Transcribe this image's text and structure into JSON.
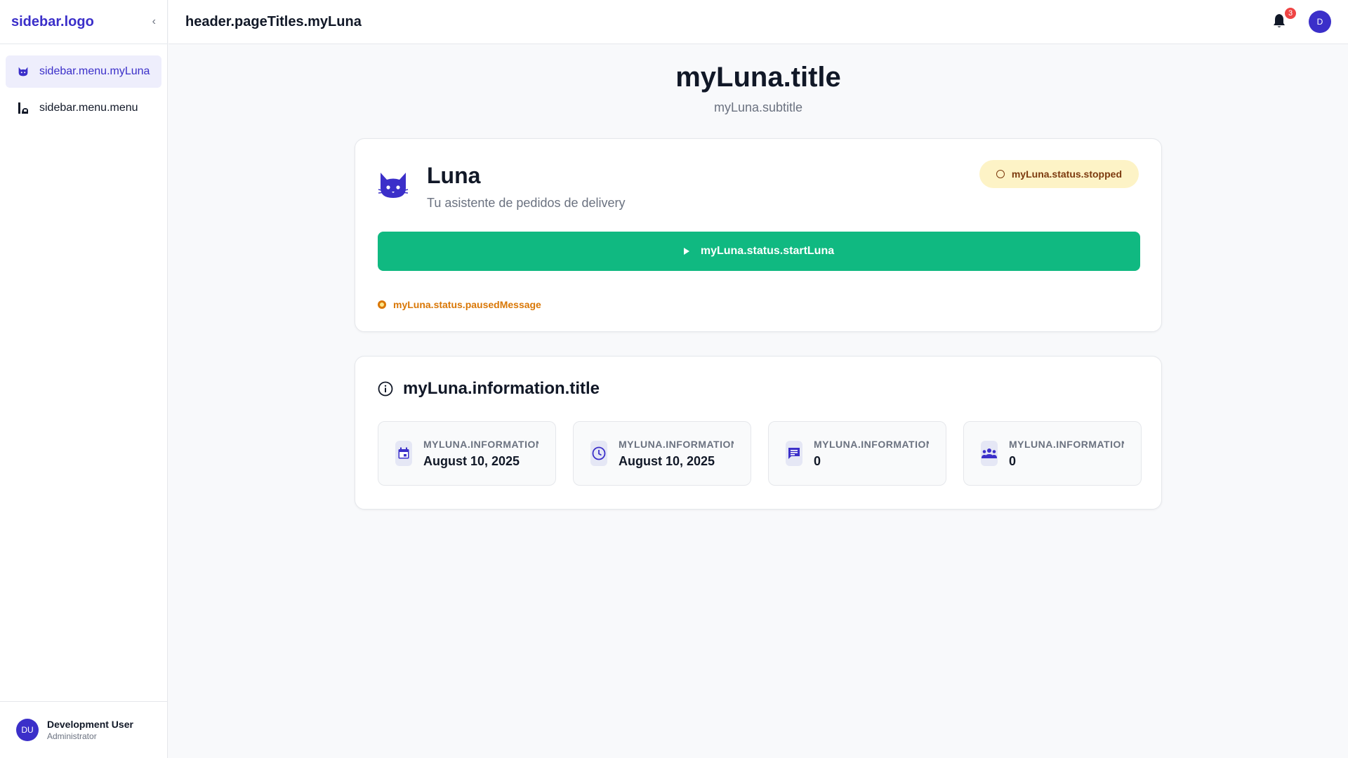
{
  "sidebar": {
    "logo": "sidebar.logo",
    "items": [
      {
        "label": "sidebar.menu.myLuna",
        "icon": "cat-icon",
        "active": true
      },
      {
        "label": "sidebar.menu.menu",
        "icon": "food-icon",
        "active": false
      }
    ],
    "user": {
      "initials": "DU",
      "name": "Development User",
      "role": "Administrator"
    }
  },
  "header": {
    "title": "header.pageTitles.myLuna",
    "notifications": "3",
    "avatar_initial": "D"
  },
  "main": {
    "title": "myLuna.title",
    "subtitle": "myLuna.subtitle",
    "luna": {
      "name": "Luna",
      "description": "Tu asistente de pedidos de delivery",
      "status": "myLuna.status.stopped",
      "start_button": "myLuna.status.startLuna",
      "paused_message": "myLuna.status.pausedMessage"
    },
    "information": {
      "title": "myLuna.information.title",
      "cells": [
        {
          "label": "MYLUNA.INFORMATION.CREATEDAT",
          "value": "August 10, 2025",
          "icon": "calendar-icon"
        },
        {
          "label": "MYLUNA.INFORMATION.LASTUPDATED",
          "value": "August 10, 2025",
          "icon": "clock-icon"
        },
        {
          "label": "MYLUNA.INFORMATION.TOTALCONVERSATIONS",
          "value": "0",
          "icon": "chat-icon"
        },
        {
          "label": "MYLUNA.INFORMATION.ACTIVEUSERS",
          "value": "0",
          "icon": "users-icon"
        }
      ]
    }
  },
  "colors": {
    "accent": "#3b2fc9",
    "success": "#10b981",
    "warning": "#d97706",
    "badge_bg": "#fdf3c6",
    "notification": "#ef4444"
  }
}
